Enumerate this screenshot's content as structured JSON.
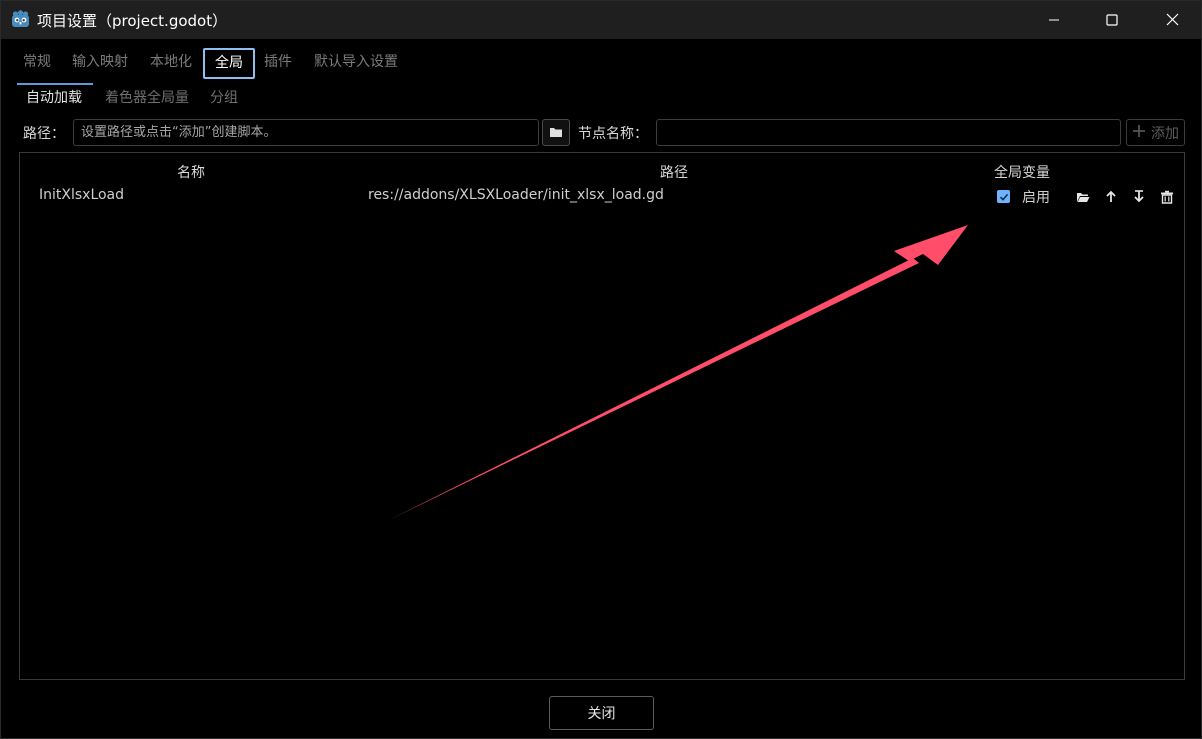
{
  "window": {
    "title": "项目设置（project.godot）",
    "app_icon": "godot-icon",
    "controls": [
      "minimize-icon",
      "maximize-icon",
      "close-icon"
    ]
  },
  "tabs": {
    "items": [
      "常规",
      "输入映射",
      "本地化",
      "全局",
      "插件",
      "默认导入设置"
    ],
    "active": "全局"
  },
  "subtabs": {
    "items": [
      "自动加载",
      "着色器全局量",
      "分组"
    ],
    "active": "自动加载"
  },
  "autoload": {
    "path_label": "路径：",
    "path_placeholder": "设置路径或点击“添加”创建脚本。",
    "path_value": "",
    "node_label": "节点名称：",
    "node_value": "",
    "add_label": "添加"
  },
  "table": {
    "headers": {
      "name": "名称",
      "path": "路径",
      "global": "全局变量"
    },
    "rows": [
      {
        "name": "InitXlsxLoad",
        "path": "res://addons/XLSXLoader/init_xlsx_load.gd",
        "enabled": true,
        "enable_label": "启用",
        "actions": [
          "folder-open-icon",
          "move-up-icon",
          "move-down-icon",
          "trash-icon"
        ]
      }
    ]
  },
  "footer": {
    "close_label": "关闭"
  },
  "annotation": {
    "type": "arrow",
    "color": "#ff4d6a",
    "points_to": "enable-checkbox"
  },
  "colors": {
    "accent": "#5e9ad6",
    "active_tab_border": "#8fbff0",
    "checkbox": "#6fb3ff"
  }
}
